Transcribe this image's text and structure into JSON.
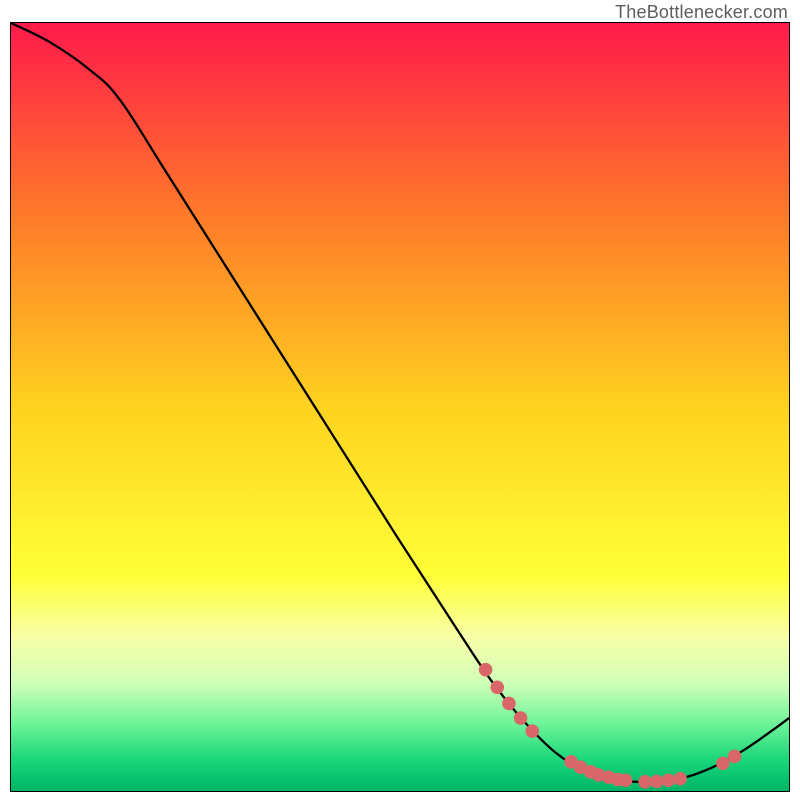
{
  "attribution": "TheBottlenecker.com",
  "chart_data": {
    "type": "line",
    "title": "",
    "xlabel": "",
    "ylabel": "",
    "xlim": [
      0,
      100
    ],
    "ylim": [
      0,
      100
    ],
    "gradient_stops": [
      {
        "offset": 0,
        "color": "#ff1a4b"
      },
      {
        "offset": 25,
        "color": "#ff7a2a"
      },
      {
        "offset": 50,
        "color": "#ffd21f"
      },
      {
        "offset": 72,
        "color": "#ffff38"
      },
      {
        "offset": 80,
        "color": "#f8ffa8"
      },
      {
        "offset": 86,
        "color": "#cfffb8"
      },
      {
        "offset": 91,
        "color": "#72f59a"
      },
      {
        "offset": 96,
        "color": "#19d67a"
      },
      {
        "offset": 100,
        "color": "#00b566"
      }
    ],
    "series": [
      {
        "name": "bottleneck-curve",
        "type": "line",
        "color": "#000000",
        "points": [
          {
            "x": 0,
            "y": 100
          },
          {
            "x": 5,
            "y": 97.5
          },
          {
            "x": 10,
            "y": 94
          },
          {
            "x": 14,
            "y": 90
          },
          {
            "x": 20,
            "y": 80.5
          },
          {
            "x": 30,
            "y": 64.5
          },
          {
            "x": 40,
            "y": 48.5
          },
          {
            "x": 50,
            "y": 32.5
          },
          {
            "x": 58,
            "y": 20
          },
          {
            "x": 62,
            "y": 14
          },
          {
            "x": 66,
            "y": 9
          },
          {
            "x": 70,
            "y": 5
          },
          {
            "x": 74,
            "y": 2.5
          },
          {
            "x": 78,
            "y": 1.4
          },
          {
            "x": 82,
            "y": 1.2
          },
          {
            "x": 86,
            "y": 1.6
          },
          {
            "x": 90,
            "y": 3
          },
          {
            "x": 94,
            "y": 5.2
          },
          {
            "x": 98,
            "y": 8
          },
          {
            "x": 100,
            "y": 9.5
          }
        ]
      },
      {
        "name": "highlight-markers",
        "type": "scatter",
        "color": "#d9676a",
        "points": [
          {
            "x": 61,
            "y": 15.8
          },
          {
            "x": 62.5,
            "y": 13.5
          },
          {
            "x": 64,
            "y": 11.4
          },
          {
            "x": 65.5,
            "y": 9.5
          },
          {
            "x": 67,
            "y": 7.8
          },
          {
            "x": 72,
            "y": 3.8
          },
          {
            "x": 73.2,
            "y": 3.1
          },
          {
            "x": 74.5,
            "y": 2.5
          },
          {
            "x": 75.5,
            "y": 2.1
          },
          {
            "x": 76.8,
            "y": 1.8
          },
          {
            "x": 78,
            "y": 1.5
          },
          {
            "x": 79,
            "y": 1.4
          },
          {
            "x": 81.5,
            "y": 1.2
          },
          {
            "x": 83,
            "y": 1.25
          },
          {
            "x": 84.5,
            "y": 1.4
          },
          {
            "x": 86,
            "y": 1.6
          },
          {
            "x": 91.5,
            "y": 3.6
          },
          {
            "x": 93,
            "y": 4.5
          }
        ]
      }
    ]
  }
}
